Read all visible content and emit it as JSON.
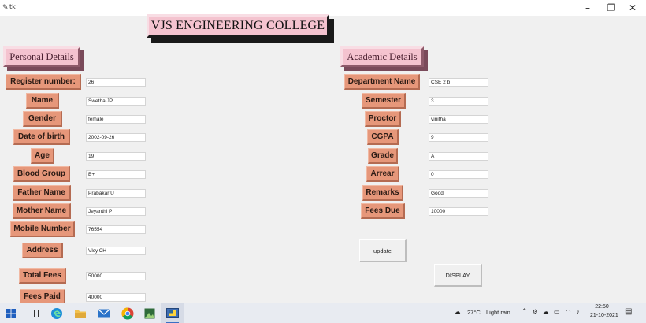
{
  "window": {
    "title": "tk",
    "controls": {
      "minimize": "–",
      "maximize": "❐",
      "close": "✕"
    }
  },
  "header": {
    "college_name": "VJS ENGINEERING COLLEGE"
  },
  "personal": {
    "heading": "Personal Details",
    "labels": {
      "register": "Register number:",
      "name": "Name",
      "gender": "Gender",
      "dob": "Date of birth",
      "age": "Age",
      "blood": "Blood Group",
      "father": "Father Name",
      "mother": "Mother Name",
      "mobile": "Mobile Number",
      "address": "Address",
      "total_fees": "Total Fees",
      "fees_paid": "Fees Paid"
    },
    "values": {
      "register": "26",
      "name": "Swetha JP",
      "gender": "female",
      "dob": "2002-09-26",
      "age": "19",
      "blood": "B+",
      "father": "Prabakar U",
      "mother": "Jeyanthi P",
      "mobile": "76554",
      "address": "Vlcy,CH",
      "total_fees": "50000",
      "fees_paid": "40000"
    }
  },
  "academic": {
    "heading": "Academic Details",
    "labels": {
      "department": "Department Name",
      "semester": "Semester",
      "proctor": "Proctor",
      "cgpa": "CGPA",
      "grade": "Grade",
      "arrear": "Arrear",
      "remarks": "Remarks",
      "fees_due": "Fees Due"
    },
    "values": {
      "department": "CSE 2 b",
      "semester": "3",
      "proctor": "vinitha",
      "cgpa": "9",
      "grade": "A",
      "arrear": "0",
      "remarks": "Good",
      "fees_due": "10000"
    }
  },
  "actions": {
    "update": "update",
    "display": "DISPLAY"
  },
  "taskbar": {
    "weather_temp": "27°C",
    "weather_desc": "Light rain",
    "time": "22:50",
    "date": "21-10-2021",
    "icons": [
      "windows-start-icon",
      "task-view-icon",
      "edge-browser-icon",
      "file-explorer-icon",
      "mail-icon",
      "chrome-icon",
      "photos-icon",
      "python-icon"
    ]
  }
}
